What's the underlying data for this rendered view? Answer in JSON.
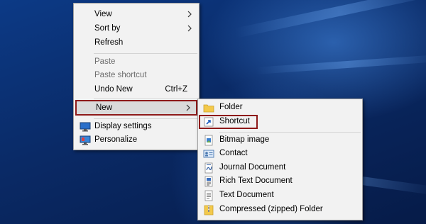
{
  "context_menu": {
    "items": [
      {
        "label": "View"
      },
      {
        "label": "Sort by"
      },
      {
        "label": "Refresh"
      },
      {
        "label": "Paste"
      },
      {
        "label": "Paste shortcut"
      },
      {
        "label": "Undo New",
        "shortcut": "Ctrl+Z"
      },
      {
        "label": "New"
      },
      {
        "label": "Display settings"
      },
      {
        "label": "Personalize"
      }
    ]
  },
  "new_submenu": {
    "items": [
      {
        "label": "Folder"
      },
      {
        "label": "Shortcut"
      },
      {
        "label": "Bitmap image"
      },
      {
        "label": "Contact"
      },
      {
        "label": "Journal Document"
      },
      {
        "label": "Rich Text Document"
      },
      {
        "label": "Text Document"
      },
      {
        "label": "Compressed (zipped) Folder"
      }
    ]
  },
  "colors": {
    "highlight_border": "#8e1a1a",
    "menu_bg": "#f2f2f2",
    "desktop": "#0a2a66"
  }
}
